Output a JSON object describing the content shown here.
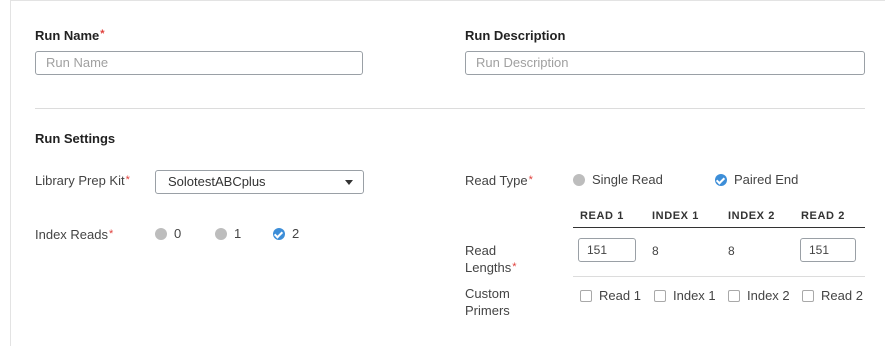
{
  "run_name": {
    "label": "Run Name",
    "placeholder": "Run Name"
  },
  "run_description": {
    "label": "Run Description",
    "placeholder": "Run Description"
  },
  "run_settings": {
    "title": "Run Settings",
    "library_prep_kit": {
      "label": "Library Prep Kit",
      "value": "SolotestABCplus"
    },
    "index_reads": {
      "label": "Index Reads",
      "options": [
        "0",
        "1",
        "2"
      ],
      "selected": "2"
    },
    "read_type": {
      "label": "Read Type",
      "options": [
        "Single Read",
        "Paired End"
      ],
      "selected": "Paired End"
    },
    "read_lengths": {
      "label": "Read Lengths",
      "columns": [
        "READ 1",
        "INDEX 1",
        "INDEX 2",
        "READ 2"
      ],
      "values": [
        "151",
        "8",
        "8",
        "151"
      ]
    },
    "custom_primers": {
      "label": "Custom Primers",
      "options": [
        "Read 1",
        "Index 1",
        "Index 2",
        "Read 2"
      ]
    }
  },
  "required_mark": "*",
  "colors": {
    "accent": "#3d8ed8",
    "required": "#e0403c",
    "unselected": "#bdbdbd"
  }
}
